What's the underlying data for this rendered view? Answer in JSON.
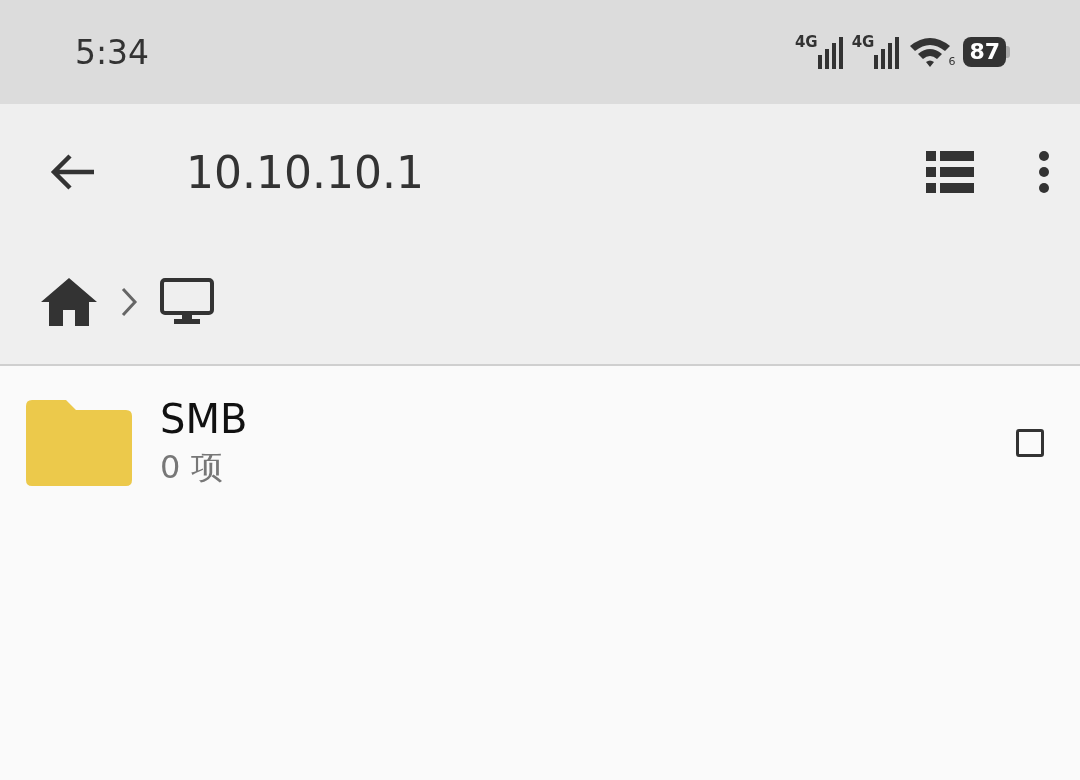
{
  "status_bar": {
    "time": "5:34",
    "sim_labels": [
      "4G",
      "4G"
    ],
    "wifi_label": "6",
    "battery": "87"
  },
  "toolbar": {
    "title": "10.10.10.1"
  },
  "breadcrumb": [
    {
      "kind": "home"
    },
    {
      "kind": "computer"
    }
  ],
  "items": [
    {
      "name": "SMB",
      "count": "0 项",
      "checked": false
    }
  ]
}
